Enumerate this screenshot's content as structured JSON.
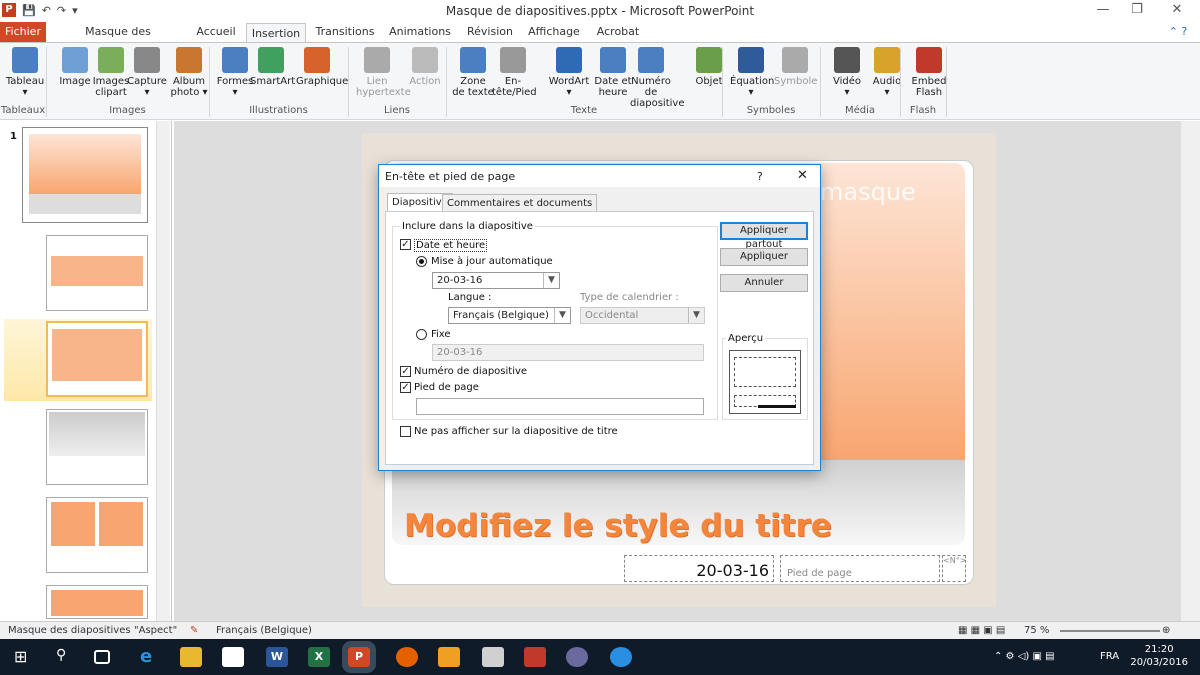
{
  "window": {
    "title": "Masque de diapositives.pptx - Microsoft PowerPoint",
    "qat": [
      "💾",
      "↶",
      "↷",
      "▾"
    ]
  },
  "tabs": [
    "Fichier",
    "Masque des diapositives",
    "Accueil",
    "Insertion",
    "Transitions",
    "Animations",
    "Révision",
    "Affichage",
    "Acrobat"
  ],
  "active_tab": "Insertion",
  "ribbon": {
    "buttons": [
      {
        "label": "Tableau",
        "sub": "▾",
        "color": "#4a7fc1"
      },
      {
        "label": "Image",
        "sub": "",
        "color": "#6ea0d6"
      },
      {
        "label": "Images",
        "sub": "clipart",
        "color": "#7aae5a"
      },
      {
        "label": "Capture",
        "sub": "▾",
        "color": "#888"
      },
      {
        "label": "Album",
        "sub": "photo ▾",
        "color": "#c9772f"
      },
      {
        "label": "Formes",
        "sub": "▾",
        "color": "#4a7fc1"
      },
      {
        "label": "SmartArt",
        "sub": "",
        "color": "#3fa05f"
      },
      {
        "label": "Graphique",
        "sub": "",
        "color": "#d8622b"
      },
      {
        "label": "Lien",
        "sub": "hypertexte",
        "color": "#aaa"
      },
      {
        "label": "Action",
        "sub": "",
        "color": "#bbb"
      },
      {
        "label": "Zone",
        "sub": "de texte",
        "color": "#4a7fc1"
      },
      {
        "label": "En-tête/Pied",
        "sub": "",
        "color": "#999"
      },
      {
        "label": "WordArt",
        "sub": "▾",
        "color": "#2f6bb4"
      },
      {
        "label": "Date et",
        "sub": "heure",
        "color": "#4a7fc1"
      },
      {
        "label": "Numéro de",
        "sub": "diapositive",
        "color": "#4a7fc1"
      },
      {
        "label": "Objet",
        "sub": "",
        "color": "#6a9e4a"
      },
      {
        "label": "Équation",
        "sub": "▾",
        "color": "#2f5b9a"
      },
      {
        "label": "Symbole",
        "sub": "",
        "color": "#aaa"
      },
      {
        "label": "Vidéo",
        "sub": "▾",
        "color": "#555"
      },
      {
        "label": "Audio",
        "sub": "▾",
        "color": "#d8a22b"
      },
      {
        "label": "Embed",
        "sub": "Flash",
        "color": "#c0392b"
      }
    ],
    "groups": [
      "Tableaux",
      "Images",
      "Illustrations",
      "Liens",
      "Texte",
      "Symboles",
      "Média",
      "Flash"
    ]
  },
  "slide": {
    "title": "Modifiez le style du titre",
    "masque_text": "masque",
    "date": "20-03-16",
    "footer": "Pied de page",
    "num": "<N°>"
  },
  "thumbnail_number": "1",
  "dialog": {
    "title": "En-tête et pied de page",
    "help": "?",
    "close": "✕",
    "tab1": "Diapositive",
    "tab2": "Commentaires et documents",
    "include_label": "Inclure dans la diapositive",
    "date_heure": "Date et heure",
    "mise_a_jour": "Mise à jour automatique",
    "date_value": "20-03-16",
    "langue_label": "Langue :",
    "langue_value": "Français (Belgique)",
    "cal_label": "Type de calendrier :",
    "cal_value": "Occidental",
    "fixe": "Fixe",
    "fixe_value": "20-03-16",
    "numero": "Numéro de diapositive",
    "pied": "Pied de page",
    "pied_value": "",
    "ne_pas": "Ne pas afficher sur la diapositive de titre",
    "btn_apply_all": "Appliquer partout",
    "btn_apply": "Appliquer",
    "btn_cancel": "Annuler",
    "apercu": "Aperçu"
  },
  "status": {
    "view": "Masque des diapositives",
    "theme": "\"Aspect\"",
    "lang": "Français (Belgique)",
    "zoom": "75 %"
  },
  "taskbar": {
    "time": "21:20",
    "date": "20/03/2016",
    "lang": "FRA"
  }
}
